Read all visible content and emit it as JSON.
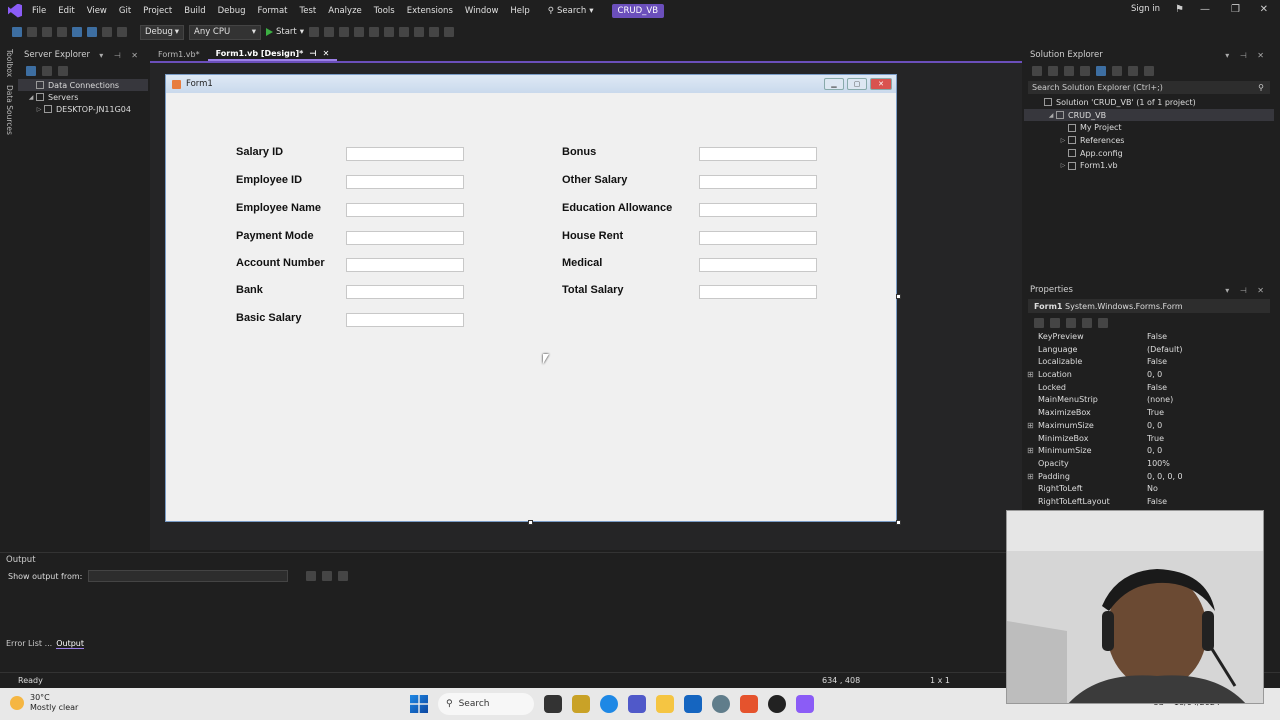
{
  "menubar": {
    "items": [
      "File",
      "Edit",
      "View",
      "Git",
      "Project",
      "Build",
      "Debug",
      "Format",
      "Test",
      "Analyze",
      "Tools",
      "Extensions",
      "Window",
      "Help"
    ],
    "search_label": "Search",
    "solution_name": "CRUD_VB",
    "signin_label": "Sign in"
  },
  "toolbar": {
    "configuration": "Debug",
    "platform": "Any CPU",
    "start_label": "Start"
  },
  "left_rail": {
    "toolbox_label": "Toolbox",
    "datasources_label": "Data Sources"
  },
  "server_explorer": {
    "title": "Server Explorer",
    "tree": [
      {
        "label": "Data Connections",
        "depth": 1,
        "expander": "",
        "selected": true
      },
      {
        "label": "Servers",
        "depth": 1,
        "expander": "◢",
        "selected": false
      },
      {
        "label": "DESKTOP-JN11G04",
        "depth": 2,
        "expander": "▷",
        "selected": false
      }
    ]
  },
  "tabs": [
    {
      "label": "Form1.vb*",
      "active": false
    },
    {
      "label": "Form1.vb [Design]*",
      "active": true
    }
  ],
  "form": {
    "title": "Form1",
    "left_labels": [
      "Salary ID",
      "Employee ID",
      "Employee Name",
      "Payment Mode",
      "Account Number",
      "Bank",
      "Basic Salary"
    ],
    "right_labels": [
      "Bonus",
      "Other Salary",
      "Education Allowance",
      "House Rent",
      "Medical",
      "Total Salary"
    ]
  },
  "solution_explorer": {
    "title": "Solution Explorer",
    "search_placeholder": "Search Solution Explorer (Ctrl+;)",
    "tree": [
      {
        "label": "Solution 'CRUD_VB' (1 of 1 project)",
        "depth": 0,
        "expander": "",
        "selected": false
      },
      {
        "label": "CRUD_VB",
        "depth": 1,
        "expander": "◢",
        "selected": true
      },
      {
        "label": "My Project",
        "depth": 2,
        "expander": "",
        "selected": false
      },
      {
        "label": "References",
        "depth": 2,
        "expander": "▷",
        "selected": false
      },
      {
        "label": "App.config",
        "depth": 2,
        "expander": "",
        "selected": false
      },
      {
        "label": "Form1.vb",
        "depth": 2,
        "expander": "▷",
        "selected": false
      }
    ]
  },
  "properties": {
    "title": "Properties",
    "object_name": "Form1",
    "object_type": "System.Windows.Forms.Form",
    "rows": [
      {
        "name": "KeyPreview",
        "value": "False",
        "expandable": false
      },
      {
        "name": "Language",
        "value": "(Default)",
        "expandable": false
      },
      {
        "name": "Localizable",
        "value": "False",
        "expandable": false
      },
      {
        "name": "Location",
        "value": "0, 0",
        "expandable": true
      },
      {
        "name": "Locked",
        "value": "False",
        "expandable": false
      },
      {
        "name": "MainMenuStrip",
        "value": "(none)",
        "expandable": false
      },
      {
        "name": "MaximizeBox",
        "value": "True",
        "expandable": false
      },
      {
        "name": "MaximumSize",
        "value": "0, 0",
        "expandable": true
      },
      {
        "name": "MinimizeBox",
        "value": "True",
        "expandable": false
      },
      {
        "name": "MinimumSize",
        "value": "0, 0",
        "expandable": true
      },
      {
        "name": "Opacity",
        "value": "100%",
        "expandable": false
      },
      {
        "name": "Padding",
        "value": "0, 0, 0, 0",
        "expandable": true
      },
      {
        "name": "RightToLeft",
        "value": "No",
        "expandable": false
      },
      {
        "name": "RightToLeftLayout",
        "value": "False",
        "expandable": false
      }
    ]
  },
  "output": {
    "title": "Output",
    "show_from_label": "Show output from:"
  },
  "bottom_tabs": {
    "error_list": "Error List ...",
    "output": "Output"
  },
  "statusbar": {
    "status": "Ready",
    "coords": "634 , 408",
    "size": "1 x 1"
  },
  "taskbar": {
    "temperature": "30°C",
    "weather": "Mostly clear",
    "search_label": "Search",
    "language": "US",
    "date": "18/04/2024"
  },
  "colors": {
    "accent": "#6b4fbb",
    "ide_bg": "#1f1f1f",
    "form_bg": "#f0f0f0"
  }
}
